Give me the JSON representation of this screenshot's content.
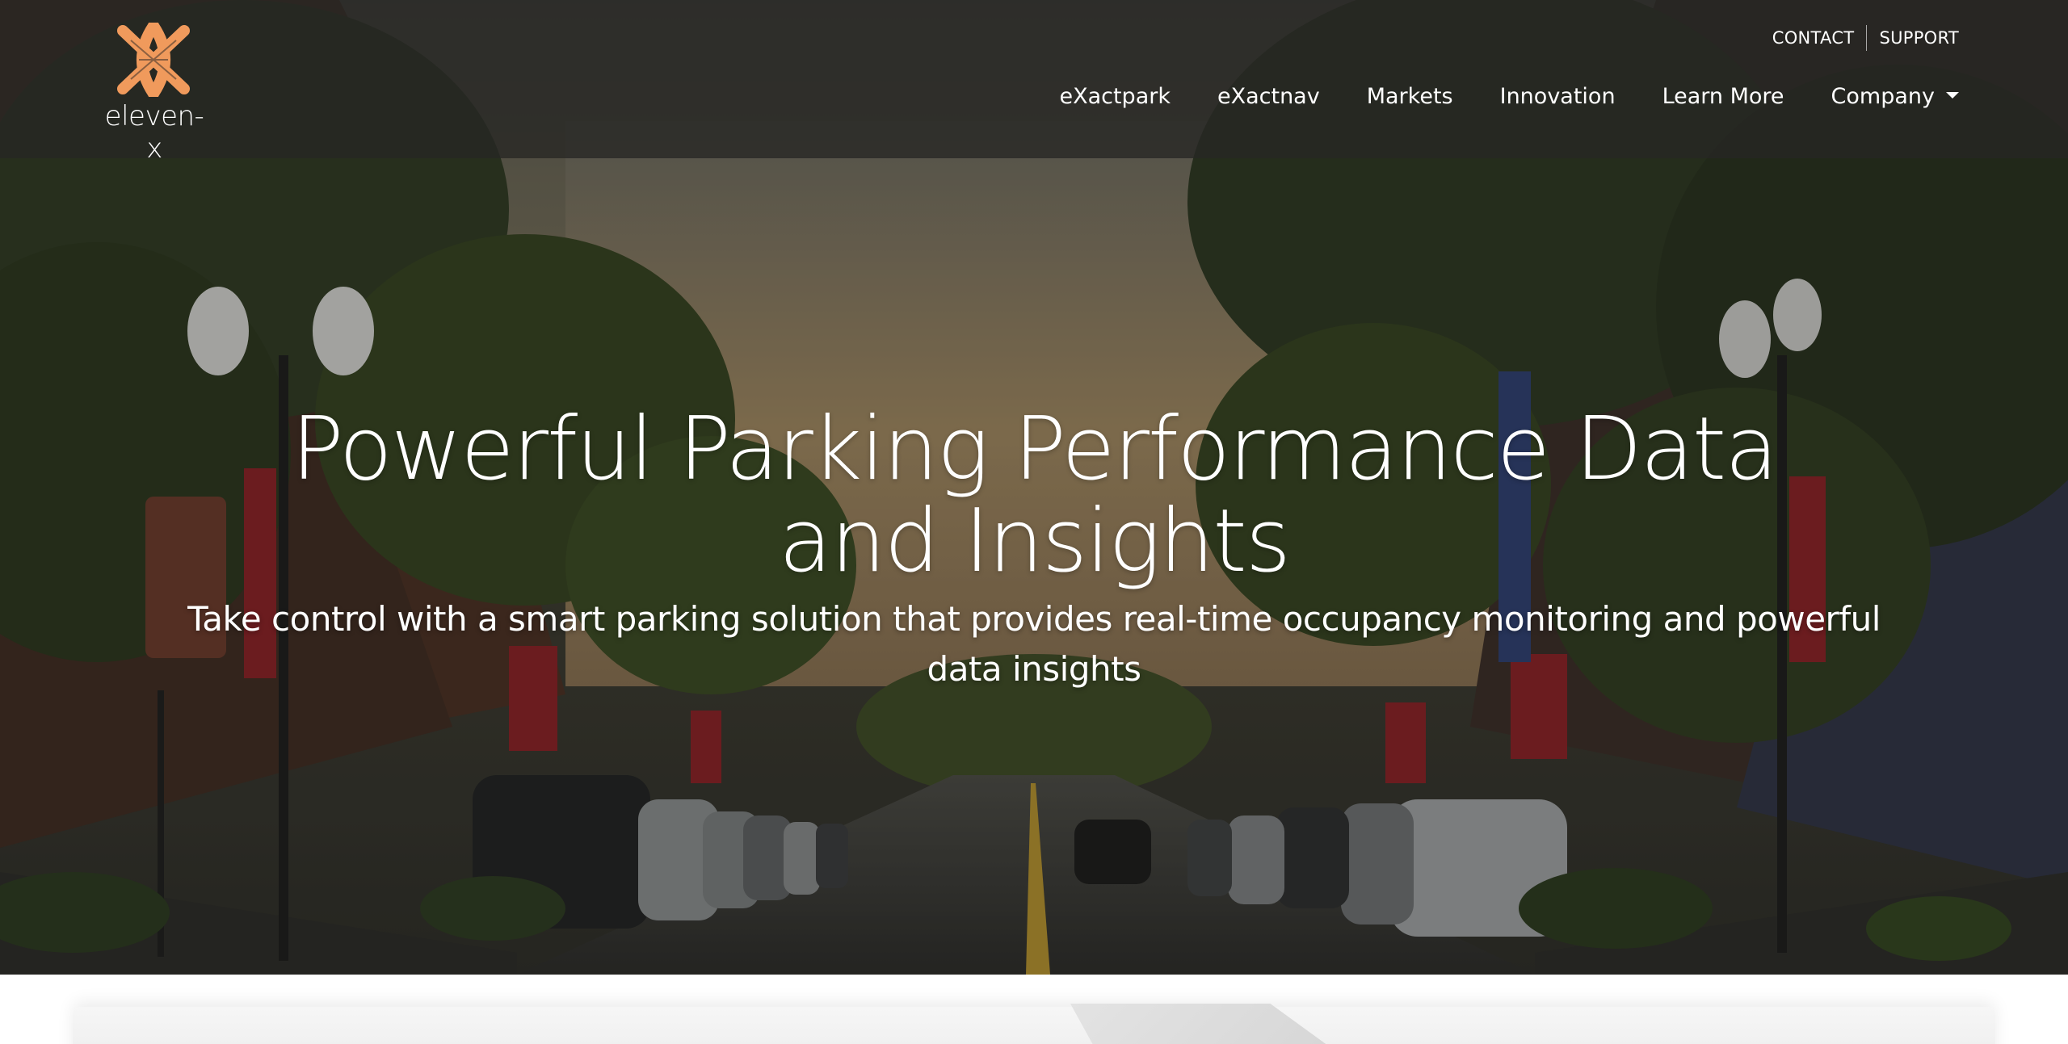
{
  "brand": {
    "name": "eleven-x",
    "logo_icon": "woven-x-icon",
    "accent_color": "#f09a5c"
  },
  "utility_nav": {
    "contact": "CONTACT",
    "support": "SUPPORT"
  },
  "main_nav": {
    "items": [
      {
        "label": "eXactpark"
      },
      {
        "label": "eXactnav"
      },
      {
        "label": "Markets"
      },
      {
        "label": "Innovation"
      },
      {
        "label": "Learn More"
      },
      {
        "label": "Company",
        "icon": "caret-down-icon"
      }
    ]
  },
  "hero": {
    "title": "Powerful Parking Performance Data and Insights",
    "subtitle": "Take control with a smart parking solution that provides real-time occupancy monitoring and powerful data insights"
  }
}
